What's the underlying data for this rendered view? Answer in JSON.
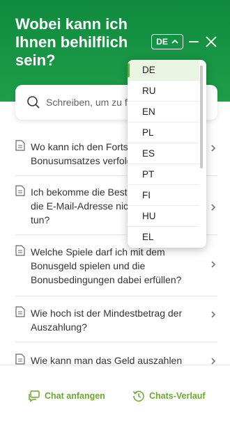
{
  "header": {
    "title": "Wobei kann ich Ihnen behilflich sein?",
    "language_button": "DE"
  },
  "search": {
    "placeholder": "Schreiben, um zu finden"
  },
  "faq": [
    {
      "question": "Wo kann ich den Fortschritt meines Bonusumsatzes verfolgen?"
    },
    {
      "question": "Ich bekomme die Bestätigung nicht an die E-Mail-Adresse nicht. Was soll ich tun?"
    },
    {
      "question": "Welche Spiele darf ich mit dem Bonusgeld spielen und die Bonusbedingungen dabei erfüllen?"
    },
    {
      "question": "Wie hoch ist der Mindestbetrag der Auszahlung?"
    },
    {
      "question": "Wie kann man das Geld auszahlen"
    }
  ],
  "language_dropdown": {
    "selected": "DE",
    "options": [
      "DE",
      "RU",
      "EN",
      "PL",
      "ES",
      "PT",
      "FI",
      "HU",
      "EL"
    ]
  },
  "footer": {
    "chat_start": "Chat anfangen",
    "chat_history": "Chats-Verlauf"
  },
  "colors": {
    "header_green": "#1f9e4a",
    "accent_green": "#6aa82f"
  }
}
